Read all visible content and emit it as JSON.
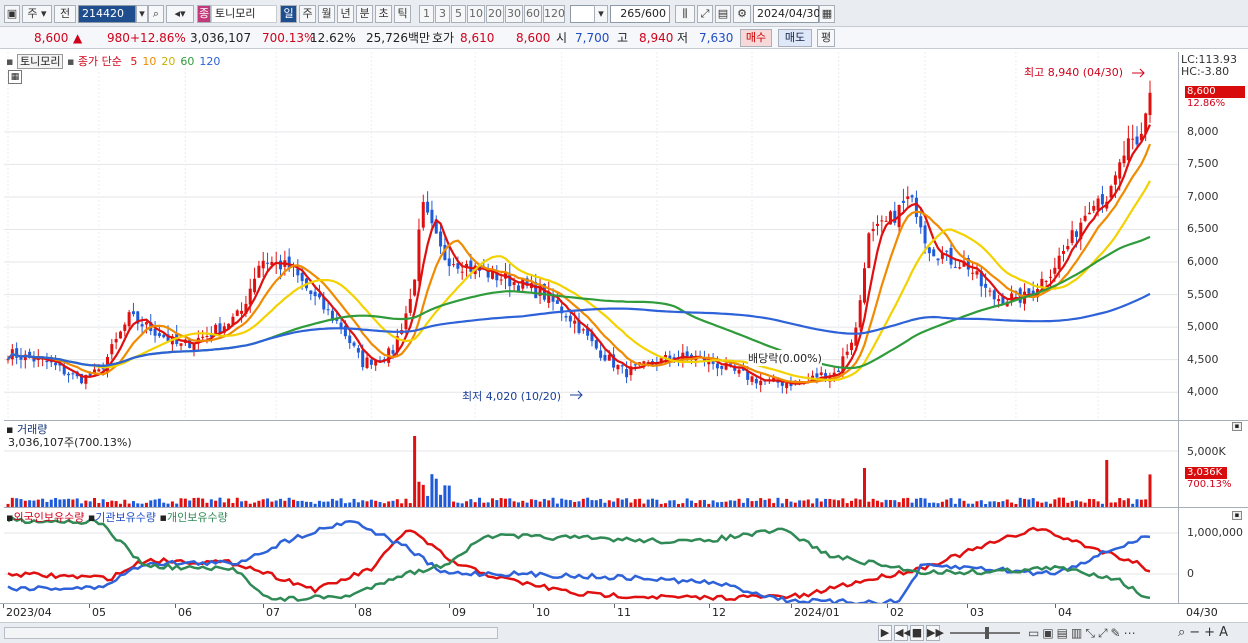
{
  "toolbar": {
    "stock_code": "214420",
    "market_type": "주",
    "prev_label": "전",
    "stock_badge": "종",
    "stock_name": "토니모리",
    "periods": [
      "일",
      "주",
      "월",
      "년",
      "분",
      "초",
      "틱"
    ],
    "active_period": "일",
    "numbers": [
      "1",
      "3",
      "5",
      "10",
      "20",
      "30",
      "60",
      "120"
    ],
    "count_value": "265",
    "count_total": "/600",
    "date": "2024/04/30"
  },
  "quote": {
    "price": "8,600",
    "arrow": "▲",
    "change": "980",
    "change_pct": "+12.86%",
    "volume": "3,036,107",
    "volume_pct": "700.13%",
    "turnover": "12.62%",
    "amount": "25,726백만",
    "bid_label": "호가",
    "bid1": "8,610",
    "bid2": "8,600",
    "open_label": "시",
    "open": "7,700",
    "high_label": "고",
    "high": "8,940",
    "low_label": "저",
    "low": "7,630",
    "buy_btn": "매수",
    "sell_btn": "매도",
    "eval_btn": "평"
  },
  "price_pane": {
    "legend_name": "토니모리",
    "legend_ma": "종가 단순",
    "ma_periods": [
      "5",
      "10",
      "20",
      "60",
      "120"
    ],
    "ma_colors": [
      "#e01010",
      "#f08a00",
      "#f2d200",
      "#2f9b3a",
      "#2e62d8"
    ],
    "axis_ticks": [
      "8,000",
      "7,500",
      "7,000",
      "6,500",
      "6,000",
      "5,500",
      "5,000",
      "4,500",
      "4,000"
    ],
    "lc": "LC:113.93",
    "hc": "HC:-3.80",
    "current_price_tag": "8,600",
    "current_pct_tag": "12.86%",
    "high_annotation": "최고 8,940 (04/30)",
    "low_annotation": "최저 4,020 (10/20)",
    "dividend_annotation": "배당락(0.00%)"
  },
  "volume_pane": {
    "title": "거래량",
    "value": "3,036,107주(700.13%)",
    "axis_tick": "5,000K",
    "tag_value": "3,036K",
    "tag_pct": "700.13%"
  },
  "holdings_pane": {
    "legend": [
      "외국인보유수량",
      "기관보유수량",
      "개인보유수량"
    ],
    "axis_ticks": [
      "1,000,000",
      "0"
    ]
  },
  "x_axis": {
    "labels": [
      "2023/04",
      "05",
      "06",
      "07",
      "08",
      "09",
      "10",
      "11",
      "12",
      "2024/01",
      "02",
      "03",
      "04"
    ],
    "end_label": "04/30"
  },
  "colors": {
    "up": "#e01010",
    "down": "#1f5ad8",
    "foreign": "#e01010",
    "institution": "#2e62d8",
    "individual": "#2f8a55"
  }
}
